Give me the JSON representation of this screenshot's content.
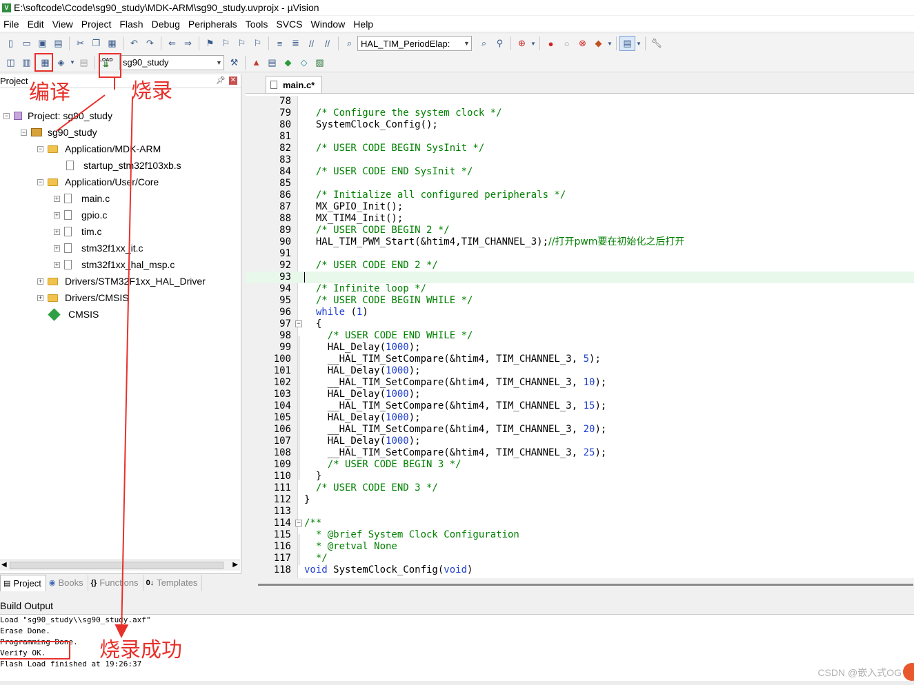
{
  "window": {
    "title": "E:\\softcode\\Ccode\\sg90_study\\MDK-ARM\\sg90_study.uvprojx - µVision",
    "icon_letter": "V"
  },
  "menu": [
    "File",
    "Edit",
    "View",
    "Project",
    "Flash",
    "Debug",
    "Peripherals",
    "Tools",
    "SVCS",
    "Window",
    "Help"
  ],
  "toolbar1": {
    "find_combo": "HAL_TIM_PeriodElap:"
  },
  "toolbar2": {
    "load_label": "LOAD",
    "target_combo": "sg90_study"
  },
  "project_panel": {
    "title": "Project",
    "tree": {
      "root": "Project: sg90_study",
      "target": "sg90_study",
      "group1": "Application/MDK-ARM",
      "file_startup": "startup_stm32f103xb.s",
      "group2": "Application/User/Core",
      "file_main": "main.c",
      "file_gpio": "gpio.c",
      "file_tim": "tim.c",
      "file_it": "stm32f1xx_it.c",
      "file_msp": "stm32f1xx_hal_msp.c",
      "group3": "Drivers/STM32F1xx_HAL_Driver",
      "group4": "Drivers/CMSIS",
      "cmsis": "CMSIS"
    },
    "tabs": {
      "project": "Project",
      "books": "Books",
      "functions": "Functions",
      "templates": "Templates"
    }
  },
  "editor": {
    "tab": "main.c*",
    "lines": {
      "l78": "",
      "l79": "  /* Configure the system clock */",
      "l80": "  SystemClock_Config();",
      "l81": "",
      "l82": "  /* USER CODE BEGIN SysInit */",
      "l83": "",
      "l84": "  /* USER CODE END SysInit */",
      "l85": "",
      "l86": "  /* Initialize all configured peripherals */",
      "l87": "  MX_GPIO_Init();",
      "l88": "  MX_TIM4_Init();",
      "l89": "  /* USER CODE BEGIN 2 */",
      "l90a": "  HAL_TIM_PWM_Start(&htim4,TIM_CHANNEL_3);",
      "l90b": "//打开pwm要在初始化之后打开",
      "l91": "",
      "l92": "  /* USER CODE END 2 */",
      "l93": "",
      "l94": "  /* Infinite loop */",
      "l95": "  /* USER CODE BEGIN WHILE */",
      "l96a": "  ",
      "l96b": "while",
      "l96c": " (",
      "l96d": "1",
      "l96e": ")",
      "l97": "  {",
      "l98": "    /* USER CODE END WHILE */",
      "l99a": "    HAL_Delay(",
      "l99b": "1000",
      "l99c": ");",
      "l100a": "    __HAL_TIM_SetCompare(&htim4, TIM_CHANNEL_3, ",
      "l100b": "5",
      "l100c": ");",
      "l101a": "    HAL_Delay(",
      "l101b": "1000",
      "l101c": ");",
      "l102a": "    __HAL_TIM_SetCompare(&htim4, TIM_CHANNEL_3, ",
      "l102b": "10",
      "l102c": ");",
      "l103a": "    HAL_Delay(",
      "l103b": "1000",
      "l103c": ");",
      "l104a": "    __HAL_TIM_SetCompare(&htim4, TIM_CHANNEL_3, ",
      "l104b": "15",
      "l104c": ");",
      "l105a": "    HAL_Delay(",
      "l105b": "1000",
      "l105c": ");",
      "l106a": "    __HAL_TIM_SetCompare(&htim4, TIM_CHANNEL_3, ",
      "l106b": "20",
      "l106c": ");",
      "l107a": "    HAL_Delay(",
      "l107b": "1000",
      "l107c": ");",
      "l108a": "    __HAL_TIM_SetCompare(&htim4, TIM_CHANNEL_3, ",
      "l108b": "25",
      "l108c": ");",
      "l109": "    /* USER CODE BEGIN 3 */",
      "l110": "  }",
      "l111": "  /* USER CODE END 3 */",
      "l112": "}",
      "l113": "",
      "l114": "/**",
      "l115": "  * @brief System Clock Configuration",
      "l116": "  * @retval None",
      "l117": "  */",
      "l118a": "void",
      "l118b": " SystemClock_Config(",
      "l118c": "void",
      "l118d": ")"
    },
    "numbers": {
      "n78": "78",
      "n79": "79",
      "n80": "80",
      "n81": "81",
      "n82": "82",
      "n83": "83",
      "n84": "84",
      "n85": "85",
      "n86": "86",
      "n87": "87",
      "n88": "88",
      "n89": "89",
      "n90": "90",
      "n91": "91",
      "n92": "92",
      "n93": "93",
      "n94": "94",
      "n95": "95",
      "n96": "96",
      "n97": "97",
      "n98": "98",
      "n99": "99",
      "n100": "100",
      "n101": "101",
      "n102": "102",
      "n103": "103",
      "n104": "104",
      "n105": "105",
      "n106": "106",
      "n107": "107",
      "n108": "108",
      "n109": "109",
      "n110": "110",
      "n111": "111",
      "n112": "112",
      "n113": "113",
      "n114": "114",
      "n115": "115",
      "n116": "116",
      "n117": "117",
      "n118": "118"
    }
  },
  "build_output": {
    "title": "Build Output",
    "lines": [
      "Load \"sg90_study\\\\sg90_study.axf\"",
      "Erase Done.",
      "Programming Done.",
      "Verify OK.",
      "Flash Load finished at 19:26:37"
    ]
  },
  "annotations": {
    "compile": "编译",
    "download": "烧录",
    "success": "烧录成功",
    "color": "#e8302a"
  },
  "watermark": "CSDN @嵌入式OG"
}
